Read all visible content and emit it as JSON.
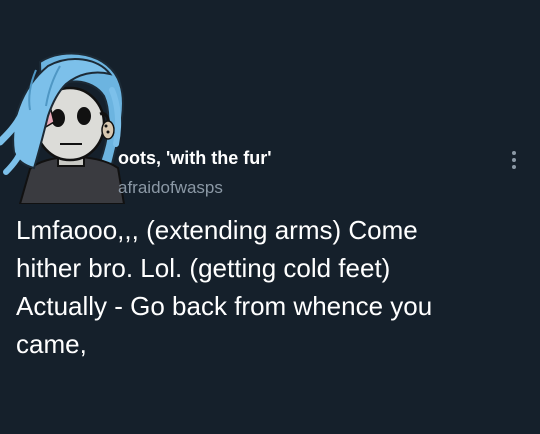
{
  "tweet": {
    "display_name": "oots, 'with the fur'",
    "handle": "afraidofwasps",
    "text": "Lmfaooo,,, (extending arms) Come\nhither bro. Lol. (getting cold feet)\nActually - Go back from whence you\ncame,"
  },
  "icons": {
    "avatar": "sally-face-avatar",
    "more": "vertical-ellipsis-icon"
  },
  "colors": {
    "background": "#15202b",
    "text_primary": "#ffffff",
    "text_secondary": "#8b98a5",
    "avatar_hair": "#6cb4e0"
  }
}
